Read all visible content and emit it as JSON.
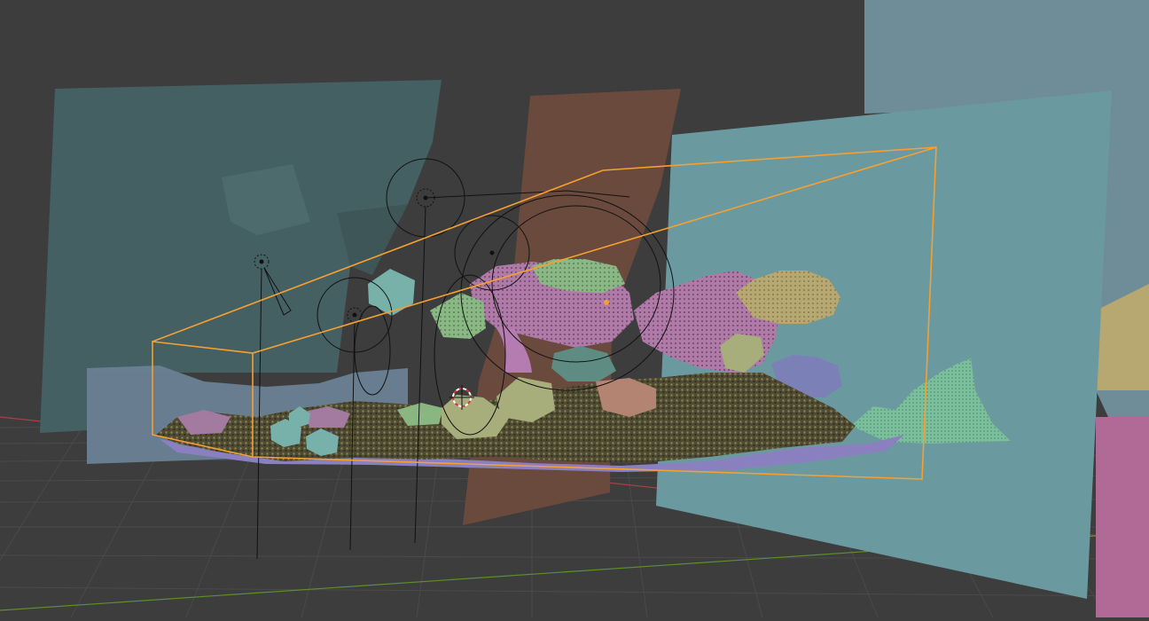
{
  "viewport": {
    "mode": "3d-viewport-solid-shading",
    "colors": {
      "background": "#3d3d3d",
      "floor_grid": "#4b4b4b",
      "x_axis": "#a8414a",
      "y_axis": "#5f8f2d",
      "selection_outline": "#f5a030",
      "wire": "#111111",
      "cursor_red": "#d23a3a"
    }
  },
  "scene_objects": [
    {
      "name": "backdrop-left",
      "color": "#456063"
    },
    {
      "name": "backdrop-brown-slab",
      "color": "#6b4a3e"
    },
    {
      "name": "backdrop-right-cyan",
      "color": "#6a9aa0"
    },
    {
      "name": "backdrop-far-right",
      "color": "#6f8d99"
    },
    {
      "name": "backdrop-pink-strip",
      "color": "#b06a95"
    },
    {
      "name": "blue-low-panel",
      "color": "#6a8195"
    },
    {
      "name": "foliage-mass",
      "color": "#5b5038"
    },
    {
      "name": "water-purple-base",
      "color": "#8a80c0"
    },
    {
      "name": "rock-mint",
      "color": "#7bbf9c"
    },
    {
      "name": "canopy-pink",
      "color": "#b878b0"
    },
    {
      "name": "canopy-tan",
      "color": "#b6a870"
    },
    {
      "name": "canopy-green",
      "color": "#8fbf8a"
    },
    {
      "name": "hex-rock-olive",
      "color": "#a7ae7b"
    },
    {
      "name": "hex-rock-teal",
      "color": "#78b0aa"
    },
    {
      "name": "camera-object"
    },
    {
      "name": "light-object-1"
    },
    {
      "name": "light-object-2"
    },
    {
      "name": "light-object-3"
    }
  ]
}
